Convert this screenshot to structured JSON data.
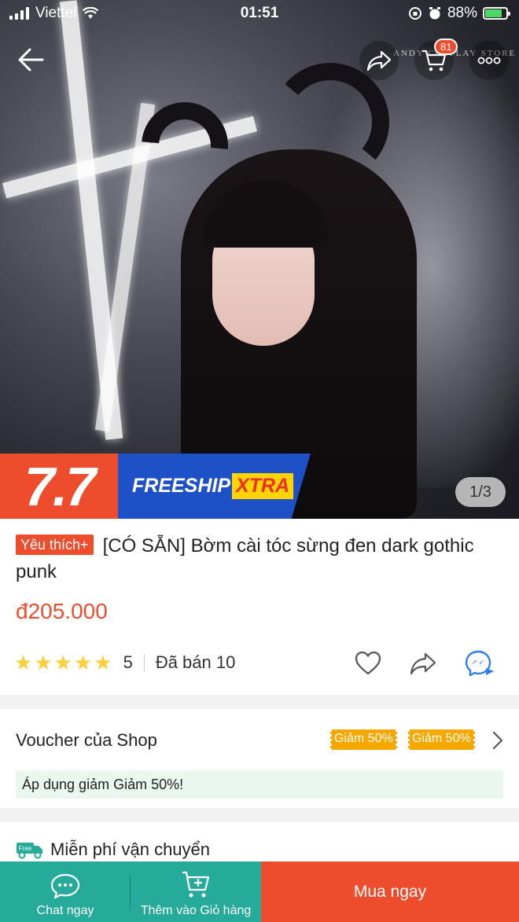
{
  "status_bar": {
    "carrier": "Viettel",
    "time": "01:51",
    "battery": "88%"
  },
  "nav": {
    "cart_count": "81",
    "watermark": "ANDY COSPLAY STORE"
  },
  "gallery": {
    "counter": "1/3"
  },
  "promo": {
    "label_77": "7.7",
    "freeship": "FREESHIP",
    "xtra": "XTRA"
  },
  "product": {
    "badge": "Yêu thích+",
    "title": "[CÓ SẴN] Bờm cài tóc sừng đen dark gothic punk",
    "price": "đ205.000",
    "rating_value": "5",
    "rating_stars": 5,
    "sold": "Đã bán 10"
  },
  "voucher": {
    "title": "Voucher của Shop",
    "tags": [
      "Giảm 50%",
      "Giảm 50%"
    ],
    "apply_text": "Áp dụng giảm Giảm 50%!"
  },
  "shipping": {
    "label": "Miễn phí vận chuyển",
    "icon_text": "Free"
  },
  "bottom_bar": {
    "chat_label": "Chat ngay",
    "cart_label": "Thêm vào Giỏ hàng",
    "buy_label": "Mua ngay"
  },
  "colors": {
    "brand": "#ee4d2d",
    "teal": "#26aa99",
    "star": "#ffce3d",
    "messenger": "#2f7ef0"
  },
  "icons": [
    "back-arrow-icon",
    "share-icon",
    "cart-icon",
    "more-icon",
    "heart-icon",
    "messenger-icon",
    "chevron-right-icon",
    "truck-icon",
    "chat-bubble-icon",
    "add-cart-icon"
  ]
}
